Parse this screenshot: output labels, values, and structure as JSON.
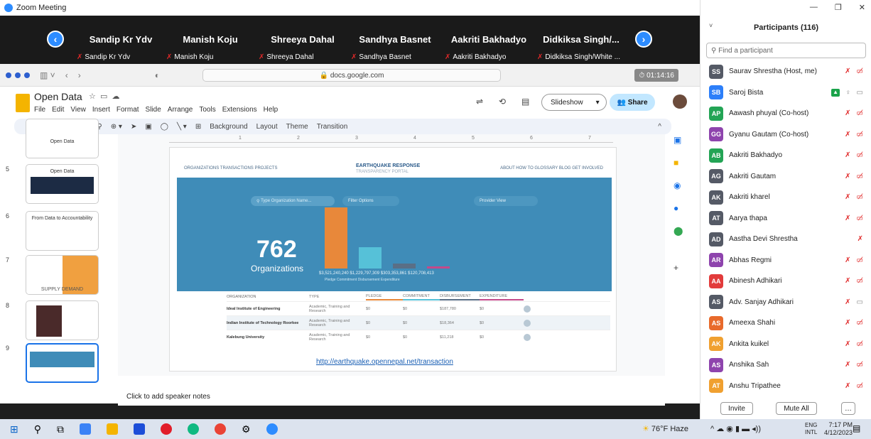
{
  "window": {
    "title": "Zoom Meeting"
  },
  "video_tiles": [
    {
      "big_name": "Sandip Kr Ydv",
      "small_name": "Sandip Kr Ydv"
    },
    {
      "big_name": "Manish Koju",
      "small_name": "Manish Koju"
    },
    {
      "big_name": "Shreeya Dahal",
      "small_name": "Shreeya Dahal"
    },
    {
      "big_name": "Sandhya Basnet",
      "small_name": "Sandhya Basnet"
    },
    {
      "big_name": "Aakriti Bakhadyo",
      "small_name": "Aakriti Bakhadyo"
    },
    {
      "big_name": "Didkiksa Singh/...",
      "small_name": "Didkiksa Singh/White ..."
    }
  ],
  "browser": {
    "url": "docs.google.com",
    "timer": "01:14:16"
  },
  "docs": {
    "title": "Open Data",
    "menu": [
      "File",
      "Edit",
      "View",
      "Insert",
      "Format",
      "Slide",
      "Arrange",
      "Tools",
      "Extensions",
      "Help"
    ],
    "slideshow_label": "Slideshow",
    "share_label": "Share",
    "toolbar": [
      "Background",
      "Layout",
      "Theme",
      "Transition"
    ],
    "notes_placeholder": "Click to add speaker notes"
  },
  "thumbnails": [
    {
      "num": "",
      "title": "Open Data"
    },
    {
      "num": "5",
      "title": "Open Data"
    },
    {
      "num": "6",
      "title": "From Data to Accountability"
    },
    {
      "num": "7",
      "title": "SUPPLY DEMAND"
    },
    {
      "num": "8",
      "title": ""
    },
    {
      "num": "9",
      "title": ""
    }
  ],
  "slide": {
    "nav_left": "ORGANIZATIONS   TRANSACTIONS   PROJECTS",
    "brand": "EARTHQUAKE RESPONSE",
    "brand_sub": "TRANSPARENCY PORTAL",
    "nav_right": "ABOUT   HOW TO   GLOSSARY   BLOG   GET INVOLVED",
    "search_placeholder": "Type Organization Name...",
    "filter_label": "Filter Options",
    "provider_label": "Provider View",
    "big_number": "762",
    "big_label": "Organizations",
    "values_text": "$3,521,240,240   $1,229,797,309   $303,353,861   $120,708,413",
    "legend_text": "Pledge     Commitment     Disbursement     Expenditure",
    "table_headers": [
      "ORGANIZATION",
      "TYPE",
      "PLEDGE",
      "COMMITMENT",
      "DISBURSEMENT",
      "EXPENDITURE"
    ],
    "table_rows": [
      {
        "org": "Ideal Institute of Engineering",
        "type": "Academic, Training and Research",
        "pledge": "$0",
        "commitment": "$0",
        "disbursement": "$187,780",
        "expenditure": "$0"
      },
      {
        "org": "Indian Institute of Technology Roorkee",
        "type": "Academic, Training and Research",
        "pledge": "$0",
        "commitment": "$0",
        "disbursement": "$18,364",
        "expenditure": "$0"
      },
      {
        "org": "Kalebung University",
        "type": "Academic, Training and Research",
        "pledge": "$0",
        "commitment": "$0",
        "disbursement": "$11,218",
        "expenditure": "$0"
      }
    ],
    "link": "http://earthquake.opennepal.net/transaction"
  },
  "chart_data": {
    "type": "bar",
    "categories": [
      "Pledge",
      "Commitment",
      "Disbursement",
      "Expenditure"
    ],
    "values": [
      3521240240,
      1229797309,
      303353861,
      120708413
    ],
    "colors": [
      "#e8883a",
      "#56c1d8",
      "#5a6f86",
      "#c44a8a"
    ]
  },
  "participants": {
    "title": "Participants (116)",
    "search_placeholder": "Find a participant",
    "list": [
      {
        "initials": "SS",
        "name": "Saurav Shrestha (Host, me)",
        "color": "#555a66",
        "icons": "mute-video"
      },
      {
        "initials": "SB",
        "name": "Saroj Bista",
        "color": "#2d7ff9",
        "icons": "share-mic-cam"
      },
      {
        "initials": "AP",
        "name": "Aawash phuyal (Co-host)",
        "color": "#23a455",
        "icons": "mute-video"
      },
      {
        "initials": "GG",
        "name": "Gyanu Gautam (Co-host)",
        "color": "#8e44ad",
        "icons": "mute-video"
      },
      {
        "initials": "AB",
        "name": "Aakriti Bakhadyo",
        "color": "#23a455",
        "icons": "mute-video"
      },
      {
        "initials": "AG",
        "name": "Aakriti Gautam",
        "color": "#555a66",
        "icons": "mute-video"
      },
      {
        "initials": "AK",
        "name": "Aakriti kharel",
        "color": "#555a66",
        "icons": "mute-video"
      },
      {
        "initials": "AT",
        "name": "Aarya thapa",
        "color": "#555a66",
        "icons": "mute-video"
      },
      {
        "initials": "AD",
        "name": "Aastha Devi Shrestha",
        "color": "#555a66",
        "icons": "mute"
      },
      {
        "initials": "AR",
        "name": "Abhas Regmi",
        "color": "#8e44ad",
        "icons": "mute-video"
      },
      {
        "initials": "AA",
        "name": "Abinesh Adhikari",
        "color": "#e23b3b",
        "icons": "mute-video"
      },
      {
        "initials": "AS",
        "name": "Adv. Sanjay Adhikari",
        "color": "#555a66",
        "icons": "mute-cam"
      },
      {
        "initials": "AS",
        "name": "Ameexa Shahi",
        "color": "#e86a2b",
        "icons": "mute-video"
      },
      {
        "initials": "AK",
        "name": "Ankita kuikel",
        "color": "#f0a030",
        "icons": "mute-video"
      },
      {
        "initials": "AS",
        "name": "Anshika Sah",
        "color": "#8e44ad",
        "icons": "mute-video"
      },
      {
        "initials": "AT",
        "name": "Anshu Tripathee",
        "color": "#f0a030",
        "icons": "mute-video"
      }
    ],
    "invite_label": "Invite",
    "mute_all_label": "Mute All"
  },
  "taskbar": {
    "weather": "76°F  Haze",
    "lang1": "ENG",
    "lang2": "INTL",
    "time": "7:17 PM",
    "date": "4/12/2023"
  }
}
